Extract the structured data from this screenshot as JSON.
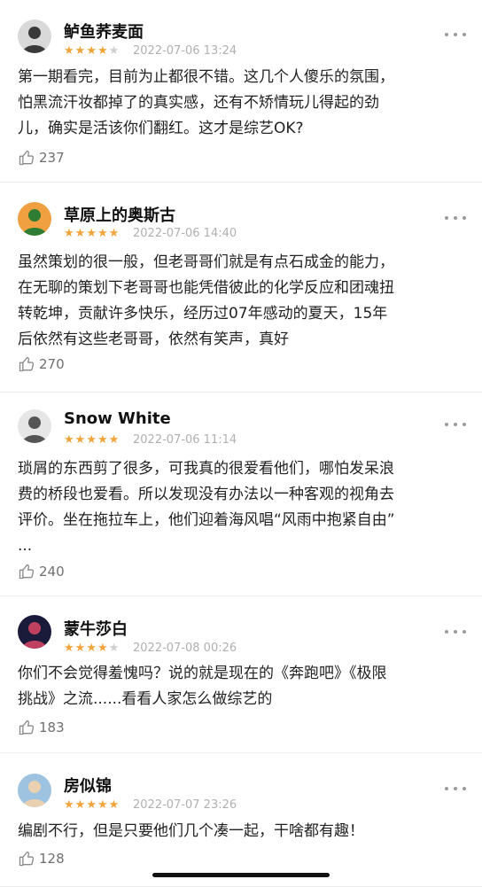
{
  "reviews": [
    {
      "username": "鲈鱼荞麦面",
      "rating": 4,
      "date": "2022-07-06 13:24",
      "text": "第一期看完，目前为止都很不错。这几个人傻乐的氛围，\n怕黑流汗妆都掉了的真实感，还有不矫情玩儿得起的劲\n儿，确实是活该你们翻红。这才是综艺OK?",
      "likes": "237",
      "avatar_colors": [
        "#d9d9d9",
        "#3a3a3a"
      ]
    },
    {
      "username": "草原上的奥斯古",
      "rating": 5,
      "date": "2022-07-06 14:40",
      "text": "虽然策划的很一般，但老哥哥们就是有点石成金的能力，\n在无聊的策划下老哥哥也能凭借彼此的化学反应和团魂扭\n转乾坤，贡献许多快乐，经历过07年感动的夏天，15年\n后依然有这些老哥哥，依然有笑声，真好",
      "likes": "270",
      "avatar_colors": [
        "#f0a040",
        "#2e7d32"
      ]
    },
    {
      "username": "Snow White",
      "rating": 5,
      "date": "2022-07-06 11:14",
      "text": "琐屑的东西剪了很多，可我真的很爱看他们，哪怕发呆浪\n费的桥段也爱看。所以发现没有办法以一种客观的视角去\n评价。坐在拖拉车上，他们迎着海风唱“风雨中抱紧自由”\n...",
      "likes": "240",
      "avatar_colors": [
        "#e6e6e6",
        "#555555"
      ]
    },
    {
      "username": "蒙牛莎白",
      "rating": 4,
      "date": "2022-07-08 00:26",
      "text": "你们不会觉得羞愧吗？说的就是现在的《奔跑吧》《极限\n挑战》之流......看看人家怎么做综艺的",
      "likes": "183",
      "avatar_colors": [
        "#1a1a3a",
        "#c04060"
      ]
    },
    {
      "username": "房似锦",
      "rating": 5,
      "date": "2022-07-07 23:26",
      "text": "编剧不行，但是只要他们几个凑一起，干啥都有趣！",
      "likes": "128",
      "avatar_colors": [
        "#9ec3e0",
        "#e8d0b0"
      ]
    }
  ],
  "colors": {
    "star_on": "#f2a33a",
    "star_off": "#cfcfcf",
    "meta": "#b0b0b0"
  },
  "icons": {
    "like": "thumbs-up-icon",
    "more": "more-horizontal-icon"
  }
}
